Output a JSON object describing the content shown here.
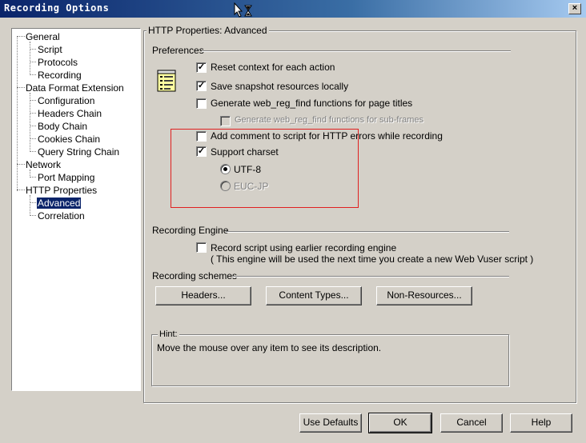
{
  "window": {
    "title": "Recording Options",
    "close_glyph": "×"
  },
  "tree": {
    "items": [
      {
        "label": "General",
        "level": 0
      },
      {
        "label": "Script",
        "level": 1
      },
      {
        "label": "Protocols",
        "level": 1
      },
      {
        "label": "Recording",
        "level": 1
      },
      {
        "label": "Data Format Extension",
        "level": 0
      },
      {
        "label": "Configuration",
        "level": 1
      },
      {
        "label": "Headers Chain",
        "level": 1
      },
      {
        "label": "Body Chain",
        "level": 1
      },
      {
        "label": "Cookies Chain",
        "level": 1
      },
      {
        "label": "Query String Chain",
        "level": 1
      },
      {
        "label": "Network",
        "level": 0
      },
      {
        "label": "Port Mapping",
        "level": 1
      },
      {
        "label": "HTTP Properties",
        "level": 0
      },
      {
        "label": "Advanced",
        "level": 1,
        "selected": true
      },
      {
        "label": "Correlation",
        "level": 1
      }
    ]
  },
  "panel": {
    "title": "HTTP Properties: Advanced",
    "preferences": {
      "heading": "Preferences",
      "icon": "notepad-icon",
      "options": [
        {
          "label": "Reset context for each action",
          "checked": true,
          "enabled": true
        },
        {
          "label": "Save snapshot resources locally",
          "checked": true,
          "enabled": true
        },
        {
          "label": "Generate web_reg_find functions for page titles",
          "checked": false,
          "enabled": true
        },
        {
          "label": "Generate web_reg_find functions for sub-frames",
          "checked": false,
          "enabled": false
        },
        {
          "label": "Add comment to script for HTTP errors while recording",
          "checked": false,
          "enabled": true
        },
        {
          "label": "Support charset",
          "checked": true,
          "enabled": true
        }
      ],
      "charsets": [
        {
          "label": "UTF-8",
          "selected": true,
          "enabled": true
        },
        {
          "label": "EUC-JP",
          "selected": false,
          "enabled": false
        }
      ]
    },
    "recording_engine": {
      "heading": "Recording Engine",
      "option_label": "Record script using earlier recording engine",
      "option_checked": false,
      "note": "( This engine will be used the next time you create a new Web Vuser script )"
    },
    "recording_schemes": {
      "heading": "Recording schemes",
      "buttons": [
        "Headers...",
        "Content Types...",
        "Non-Resources..."
      ]
    },
    "hint": {
      "heading": "Hint:",
      "text": "Move the mouse over any item to see its description."
    }
  },
  "footer": {
    "buttons": [
      "Use Defaults",
      "OK",
      "Cancel",
      "Help"
    ]
  },
  "colors": {
    "title_bar": "#0a246a",
    "selection": "#0a246a",
    "highlight_box": "#e02020",
    "face": "#d4d0c8"
  }
}
